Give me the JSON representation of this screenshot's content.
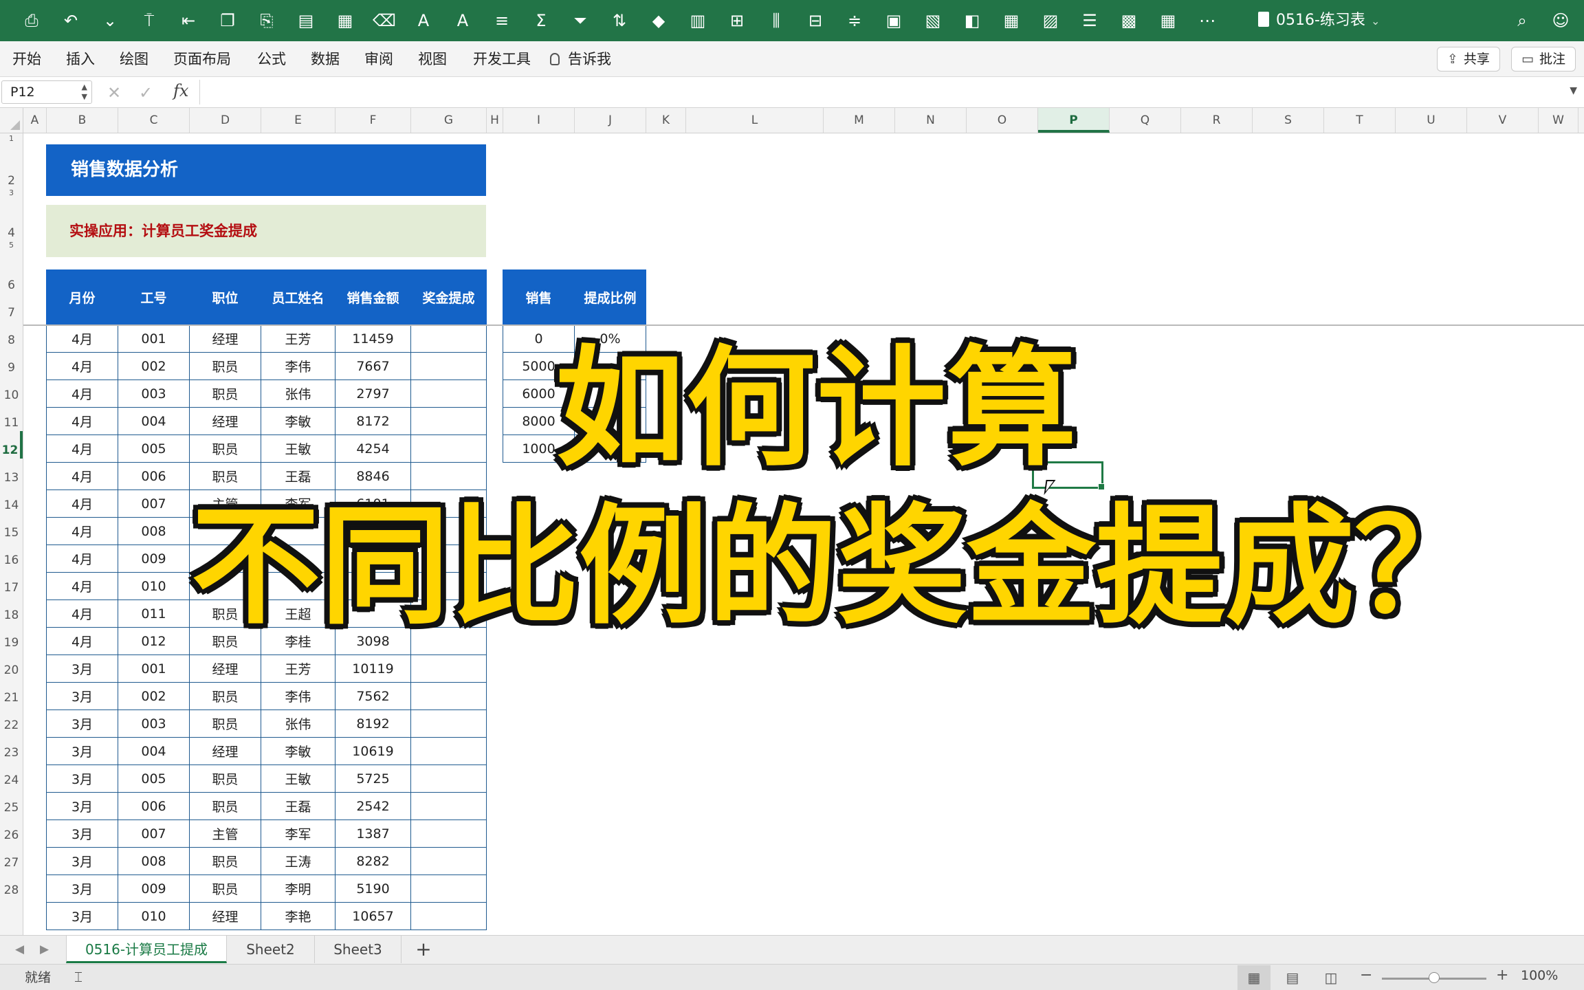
{
  "app": {
    "document_title": "0516-练习表"
  },
  "toolbar_icons": [
    "save-icon",
    "undo-icon",
    "dropdown-icon",
    "format-painter-icon",
    "indent-icon",
    "paste-special-icon",
    "paste-icon",
    "table-icon",
    "layout-icon",
    "clear-icon",
    "font-grow-icon",
    "font-shrink-icon",
    "align-icon",
    "sum-icon",
    "filter-icon",
    "sort-icon",
    "shape-icon",
    "chart-icon",
    "insert-icon",
    "distribute-icon",
    "align-center-icon",
    "align-middle-icon",
    "group-icon",
    "pivot-icon",
    "sheet-icon",
    "grid-icon",
    "fill-icon",
    "list-icon",
    "freeze-icon",
    "table-style-icon",
    "more-icon"
  ],
  "tabs": [
    "开始",
    "插入",
    "绘图",
    "页面布局",
    "公式",
    "数据",
    "审阅",
    "视图",
    "开发工具"
  ],
  "tell_me": "告诉我",
  "share_label": "共享",
  "comment_label": "批注",
  "formula": {
    "name_box": "P12",
    "fx": "fx",
    "content": ""
  },
  "columns": [
    "A",
    "B",
    "C",
    "D",
    "E",
    "F",
    "G",
    "H",
    "I",
    "J",
    "K",
    "L",
    "M",
    "N",
    "O",
    "P",
    "Q",
    "R",
    "S",
    "T",
    "U",
    "V",
    "W"
  ],
  "selected_column": "P",
  "rows": [
    "1",
    "2",
    "3",
    "4",
    "5",
    "6",
    "7",
    "8",
    "9",
    "10",
    "11",
    "12",
    "13",
    "14",
    "15",
    "16",
    "17",
    "18",
    "19",
    "20",
    "21",
    "22",
    "23",
    "24",
    "25",
    "26",
    "27",
    "28"
  ],
  "selected_row": "12",
  "sheet": {
    "title": "销售数据分析",
    "subtitle": "实操应用：计算员工奖金提成",
    "main_table": {
      "headers": [
        "月份",
        "工号",
        "职位",
        "员工姓名",
        "销售金额",
        "奖金提成"
      ],
      "rows": [
        [
          "4月",
          "001",
          "经理",
          "王芳",
          "11459",
          ""
        ],
        [
          "4月",
          "002",
          "职员",
          "李伟",
          "7667",
          ""
        ],
        [
          "4月",
          "003",
          "职员",
          "张伟",
          "2797",
          ""
        ],
        [
          "4月",
          "004",
          "经理",
          "李敏",
          "8172",
          ""
        ],
        [
          "4月",
          "005",
          "职员",
          "王敏",
          "4254",
          ""
        ],
        [
          "4月",
          "006",
          "职员",
          "王磊",
          "8846",
          ""
        ],
        [
          "4月",
          "007",
          "主管",
          "李军",
          "6101",
          ""
        ],
        [
          "4月",
          "008",
          "",
          "",
          "",
          ""
        ],
        [
          "4月",
          "009",
          "",
          "",
          "",
          ""
        ],
        [
          "4月",
          "010",
          "",
          "",
          "",
          ""
        ],
        [
          "4月",
          "011",
          "职员",
          "王超",
          "",
          ""
        ],
        [
          "4月",
          "012",
          "职员",
          "李桂",
          "3098",
          ""
        ],
        [
          "3月",
          "001",
          "经理",
          "王芳",
          "10119",
          ""
        ],
        [
          "3月",
          "002",
          "职员",
          "李伟",
          "7562",
          ""
        ],
        [
          "3月",
          "003",
          "职员",
          "张伟",
          "8192",
          ""
        ],
        [
          "3月",
          "004",
          "经理",
          "李敏",
          "10619",
          ""
        ],
        [
          "3月",
          "005",
          "职员",
          "王敏",
          "5725",
          ""
        ],
        [
          "3月",
          "006",
          "职员",
          "王磊",
          "2542",
          ""
        ],
        [
          "3月",
          "007",
          "主管",
          "李军",
          "1387",
          ""
        ],
        [
          "3月",
          "008",
          "职员",
          "王涛",
          "8282",
          ""
        ],
        [
          "3月",
          "009",
          "职员",
          "李明",
          "5190",
          ""
        ],
        [
          "3月",
          "010",
          "经理",
          "李艳",
          "10657",
          ""
        ]
      ]
    },
    "rate_table": {
      "headers": [
        "销售",
        "提成比例"
      ],
      "rows": [
        [
          "0",
          "0%"
        ],
        [
          "5000",
          ""
        ],
        [
          "6000",
          ""
        ],
        [
          "8000",
          ""
        ],
        [
          "1000",
          ""
        ]
      ]
    }
  },
  "overlay": {
    "line1": "如何计算",
    "line2": "不同比例的奖金提成？"
  },
  "sheet_tabs": [
    "0516-计算员工提成",
    "Sheet2",
    "Sheet3"
  ],
  "active_sheet_tab": "0516-计算员工提成",
  "status": {
    "text": "就绪",
    "zoom": "100%"
  },
  "colors": {
    "excel_green": "#227447",
    "header_blue": "#1363c6",
    "subtitle_bg": "#e3ecd6",
    "subtitle_text": "#b40e12",
    "overlay_yellow": "#ffd500"
  }
}
